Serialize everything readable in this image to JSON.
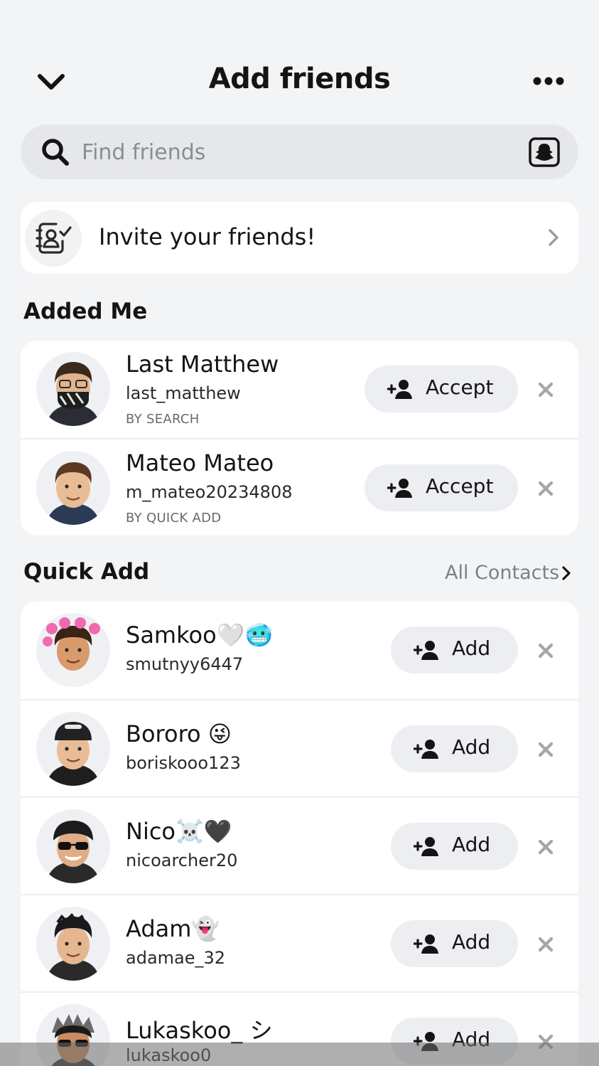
{
  "header": {
    "title": "Add friends",
    "back_icon": "chevron-down-icon",
    "more_icon": "more-dots-icon"
  },
  "search": {
    "placeholder": "Find friends",
    "value": "",
    "search_icon": "search-icon",
    "snapcode_icon": "snapcode-icon"
  },
  "invite": {
    "label": "Invite your friends!",
    "icon": "contacts-check-icon"
  },
  "added_me": {
    "title": "Added Me",
    "items": [
      {
        "name": "Last Matthew",
        "username": "last_matthew",
        "source": "BY SEARCH",
        "action": "Accept"
      },
      {
        "name": "Mateo Mateo",
        "username": "m_mateo20234808",
        "source": "BY QUICK ADD",
        "action": "Accept"
      }
    ]
  },
  "quick_add": {
    "title": "Quick Add",
    "all_contacts": "All Contacts",
    "items": [
      {
        "name": "Samkoo🤍🥶",
        "username": "smutnyy6447",
        "action": "Add"
      },
      {
        "name": "Bororo 😜",
        "username": "boriskooo123",
        "action": "Add"
      },
      {
        "name": "Nico☠️🖤",
        "username": "nicoarcher20",
        "action": "Add"
      },
      {
        "name": "Adam👻",
        "username": "adamae_32",
        "action": "Add"
      },
      {
        "name": "Lukaskoo_ シ",
        "username": "lukaskoo0",
        "action": "Add"
      }
    ]
  },
  "colors": {
    "background": "#f3f4f6",
    "card": "#ffffff",
    "pill": "#eceef1",
    "secondary_text": "#7d8187"
  }
}
